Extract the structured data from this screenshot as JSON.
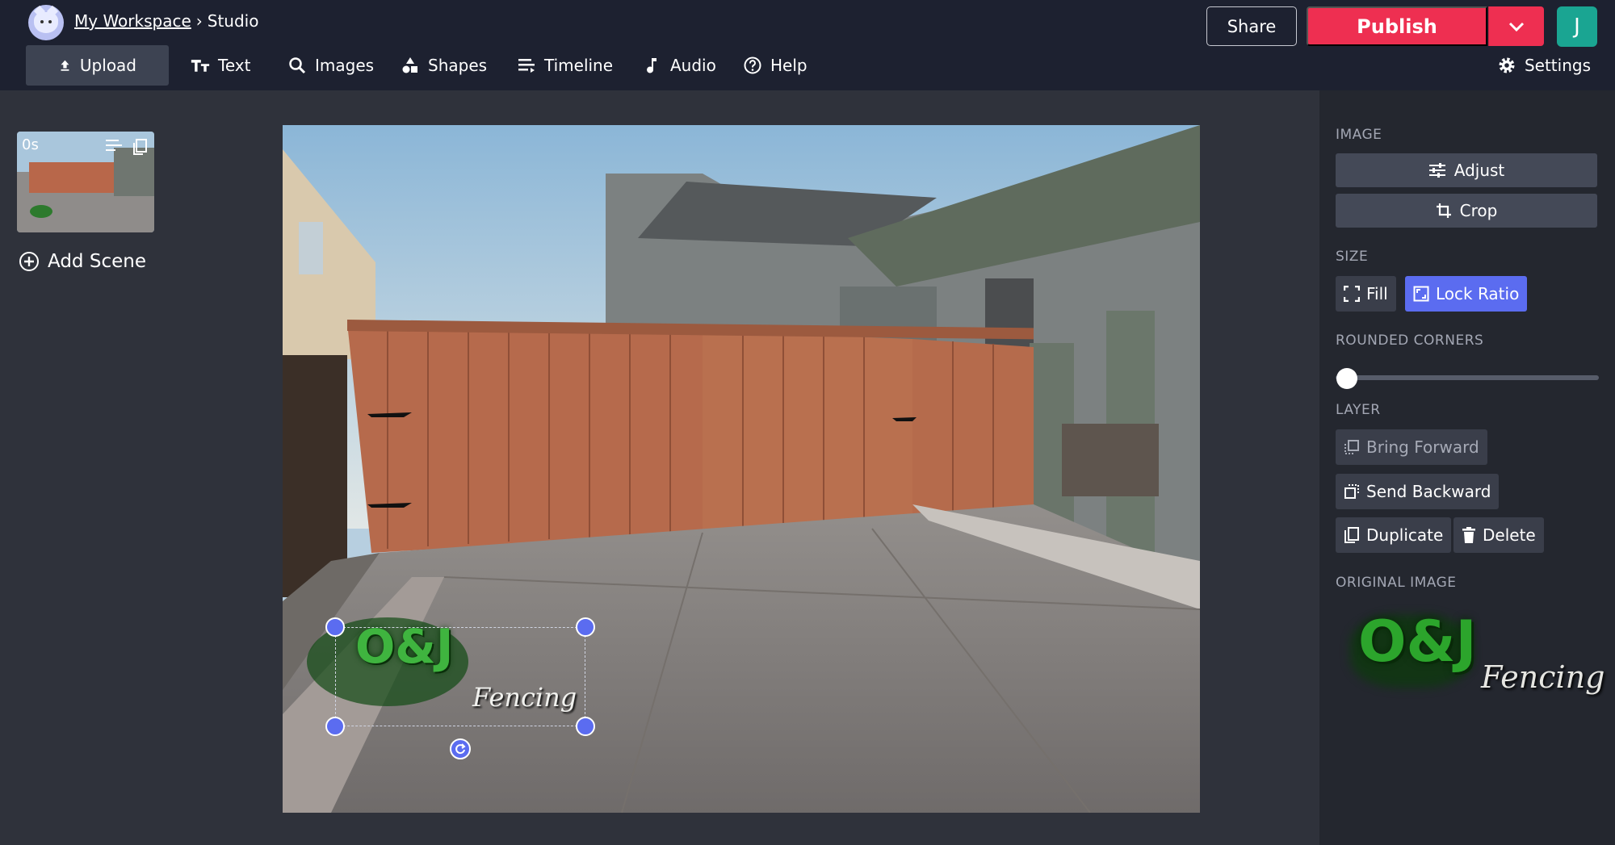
{
  "header": {
    "workspace_link": "My Workspace",
    "separator": "›",
    "current_page": "Studio",
    "share_label": "Share",
    "publish_label": "Publish",
    "avatar_initial": "J"
  },
  "toolbar": {
    "items": [
      {
        "label": "Upload",
        "icon": "upload-icon",
        "active": true
      },
      {
        "label": "Text",
        "icon": "text-icon"
      },
      {
        "label": "Images",
        "icon": "search-icon"
      },
      {
        "label": "Shapes",
        "icon": "shapes-icon"
      },
      {
        "label": "Timeline",
        "icon": "timeline-icon"
      },
      {
        "label": "Audio",
        "icon": "music-note-icon"
      },
      {
        "label": "Help",
        "icon": "help-icon"
      }
    ],
    "settings_label": "Settings"
  },
  "scenes": {
    "items": [
      {
        "time": "0s"
      }
    ],
    "add_scene_label": "Add Scene"
  },
  "canvas": {
    "logo_main": "O&J",
    "logo_script": "Fencing"
  },
  "panel": {
    "image_heading": "IMAGE",
    "adjust_label": "Adjust",
    "crop_label": "Crop",
    "size_heading": "SIZE",
    "fill_label": "Fill",
    "lock_ratio_label": "Lock Ratio",
    "rounded_heading": "ROUNDED CORNERS",
    "rounded_value": 0,
    "layer_heading": "LAYER",
    "bring_forward_label": "Bring Forward",
    "send_backward_label": "Send Backward",
    "duplicate_label": "Duplicate",
    "delete_label": "Delete",
    "original_heading": "ORIGINAL IMAGE"
  },
  "colors": {
    "topbar": "#1d2130",
    "background": "#2f323b",
    "publish": "#ee2f51",
    "accent": "#5b6cf0",
    "avatar": "#1aa592"
  }
}
